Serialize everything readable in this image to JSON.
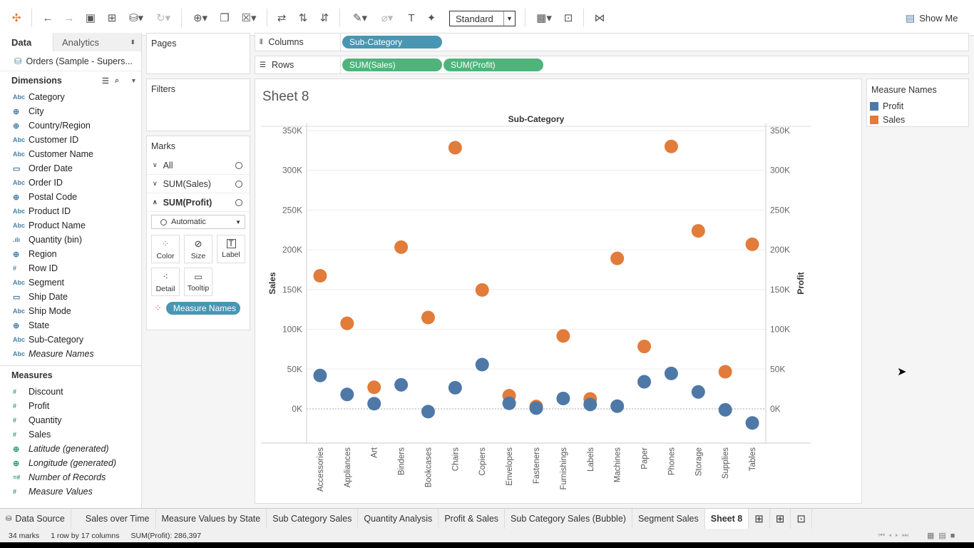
{
  "toolbar": {
    "view_mode": "Standard",
    "show_me": "Show Me"
  },
  "data_pane": {
    "tab_data": "Data",
    "tab_analytics": "Analytics",
    "datasource": "Orders (Sample - Supers...",
    "dimensions_header": "Dimensions",
    "dimensions": [
      {
        "icon": "Abc",
        "label": "Category"
      },
      {
        "icon": "globe",
        "label": "City"
      },
      {
        "icon": "globe",
        "label": "Country/Region"
      },
      {
        "icon": "Abc",
        "label": "Customer ID"
      },
      {
        "icon": "Abc",
        "label": "Customer Name"
      },
      {
        "icon": "calendar",
        "label": "Order Date"
      },
      {
        "icon": "Abc",
        "label": "Order ID"
      },
      {
        "icon": "globe",
        "label": "Postal Code"
      },
      {
        "icon": "Abc",
        "label": "Product ID"
      },
      {
        "icon": "Abc",
        "label": "Product Name"
      },
      {
        "icon": "bin",
        "label": "Quantity (bin)"
      },
      {
        "icon": "globe",
        "label": "Region"
      },
      {
        "icon": "#",
        "label": "Row ID"
      },
      {
        "icon": "Abc",
        "label": "Segment"
      },
      {
        "icon": "calendar",
        "label": "Ship Date"
      },
      {
        "icon": "Abc",
        "label": "Ship Mode"
      },
      {
        "icon": "globe",
        "label": "State"
      },
      {
        "icon": "Abc",
        "label": "Sub-Category"
      },
      {
        "icon": "Abc",
        "label": "Measure Names",
        "italic": true
      }
    ],
    "measures_header": "Measures",
    "measures": [
      {
        "icon": "#",
        "label": "Discount"
      },
      {
        "icon": "#",
        "label": "Profit"
      },
      {
        "icon": "#",
        "label": "Quantity"
      },
      {
        "icon": "#",
        "label": "Sales"
      },
      {
        "icon": "globe",
        "label": "Latitude (generated)",
        "italic": true
      },
      {
        "icon": "globe",
        "label": "Longitude (generated)",
        "italic": true
      },
      {
        "icon": "=#",
        "label": "Number of Records",
        "italic": true
      },
      {
        "icon": "#",
        "label": "Measure Values",
        "italic": true
      }
    ]
  },
  "cards": {
    "pages": "Pages",
    "filters": "Filters",
    "marks": "Marks",
    "marks_rows": [
      "All",
      "SUM(Sales)",
      "SUM(Profit)"
    ],
    "mark_type": "Automatic",
    "buttons": [
      "Color",
      "Size",
      "Label",
      "Detail",
      "Tooltip"
    ],
    "color_pill": "Measure Names"
  },
  "shelves": {
    "columns_label": "Columns",
    "rows_label": "Rows",
    "columns_pill": "Sub-Category",
    "rows_pills": [
      "SUM(Sales)",
      "SUM(Profit)"
    ]
  },
  "sheet_title": "Sheet 8",
  "legend": {
    "title": "Measure Names",
    "items": [
      {
        "label": "Profit",
        "color": "#4e79a7"
      },
      {
        "label": "Sales",
        "color": "#e17c3a"
      }
    ]
  },
  "chart_data": {
    "type": "scatter",
    "title": "Sub-Category",
    "ylabel": "Sales",
    "y2label": "Profit",
    "ylim": [
      -40000,
      360000
    ],
    "yticks": [
      "350K",
      "300K",
      "250K",
      "200K",
      "150K",
      "100K",
      "50K",
      "0K"
    ],
    "ytick_values": [
      350000,
      300000,
      250000,
      200000,
      150000,
      100000,
      50000,
      0
    ],
    "categories": [
      "Accessories",
      "Appliances",
      "Art",
      "Binders",
      "Bookcases",
      "Chairs",
      "Copiers",
      "Envelopes",
      "Fasteners",
      "Furnishings",
      "Labels",
      "Machines",
      "Paper",
      "Phones",
      "Storage",
      "Supplies",
      "Tables"
    ],
    "series": [
      {
        "name": "Sales",
        "color": "#e17c3a",
        "values": [
          167380,
          107532,
          27119,
          203413,
          114880,
          328449,
          149528,
          16476,
          3024,
          91705,
          12486,
          189239,
          78479,
          330007,
          223844,
          46674,
          206966
        ]
      },
      {
        "name": "Profit",
        "color": "#4e79a7",
        "values": [
          41937,
          18138,
          6528,
          30222,
          -3473,
          26590,
          55618,
          6964,
          950,
          13059,
          5546,
          3385,
          34054,
          44516,
          21279,
          -1189,
          -17725
        ]
      }
    ]
  },
  "sheet_tabs": [
    "Data Source",
    "Sales over Time",
    "Measure Values by State",
    "Sub Category Sales",
    "Quantity Analysis",
    "Profit & Sales",
    "Sub Category Sales (Bubble)",
    "Segment Sales",
    "Sheet 8"
  ],
  "status": {
    "marks": "34 marks",
    "layout": "1 row by 17 columns",
    "sum": "SUM(Profit): 286,397"
  }
}
